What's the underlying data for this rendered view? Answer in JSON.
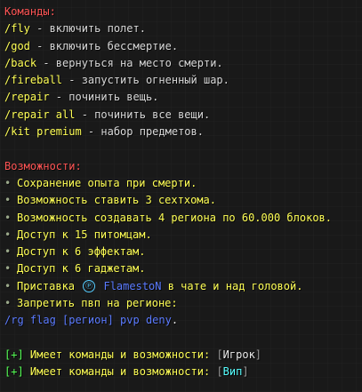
{
  "commands": {
    "heading": "Команды:",
    "items": [
      {
        "cmd": "/fly",
        "desc": " - включить полет."
      },
      {
        "cmd": "/god",
        "desc": " - включить бессмертие."
      },
      {
        "cmd": "/back",
        "desc": " - вернуться на место смерти."
      },
      {
        "cmd": "/fireball",
        "desc": " - запустить огненный шар."
      },
      {
        "cmd": "/repair",
        "desc": " - починить вещь."
      },
      {
        "cmd": "/repair all",
        "desc": " - починить все вещи."
      },
      {
        "cmd": "/kit premium",
        "desc": " - набор предметов."
      }
    ]
  },
  "features": {
    "heading": "Возможности:",
    "bullet": "•",
    "items": [
      "Сохранение опыта при смерти.",
      "Возможность ставить 3 сехтхома.",
      "Возможность создавать 4 региона по 60.000 блоков.",
      "Доступ к 15 питомцам.",
      "Доступ к 6 эффектам.",
      "Доступ к 6 гаджетам."
    ],
    "prefix_item": {
      "before": "Приставка ",
      "badge": "Ⓟ",
      "name": " FlamestoN",
      "after": " в чате и над головой."
    },
    "pvp_item": "Запретить пвп на регионе:",
    "pvp_command": "/rg flag [регион] pvp deny",
    "pvp_period": "."
  },
  "inherits": [
    {
      "plus": "[+]",
      "text": " Имеет команды и возможности: ",
      "open": "[",
      "rank": "Игрок",
      "close": "]",
      "rank_color": "#e8e8e8"
    },
    {
      "plus": "[+]",
      "text": " Имеет команды и возможности: ",
      "open": "[",
      "rank": "Вип",
      "close": "]",
      "rank_color": "#55ffff"
    }
  ],
  "colors": {
    "heading": "#ff5555",
    "command": "#ffff55",
    "perk": "#ffff55",
    "link": "#5b7bff",
    "plus": "#55ff55"
  }
}
